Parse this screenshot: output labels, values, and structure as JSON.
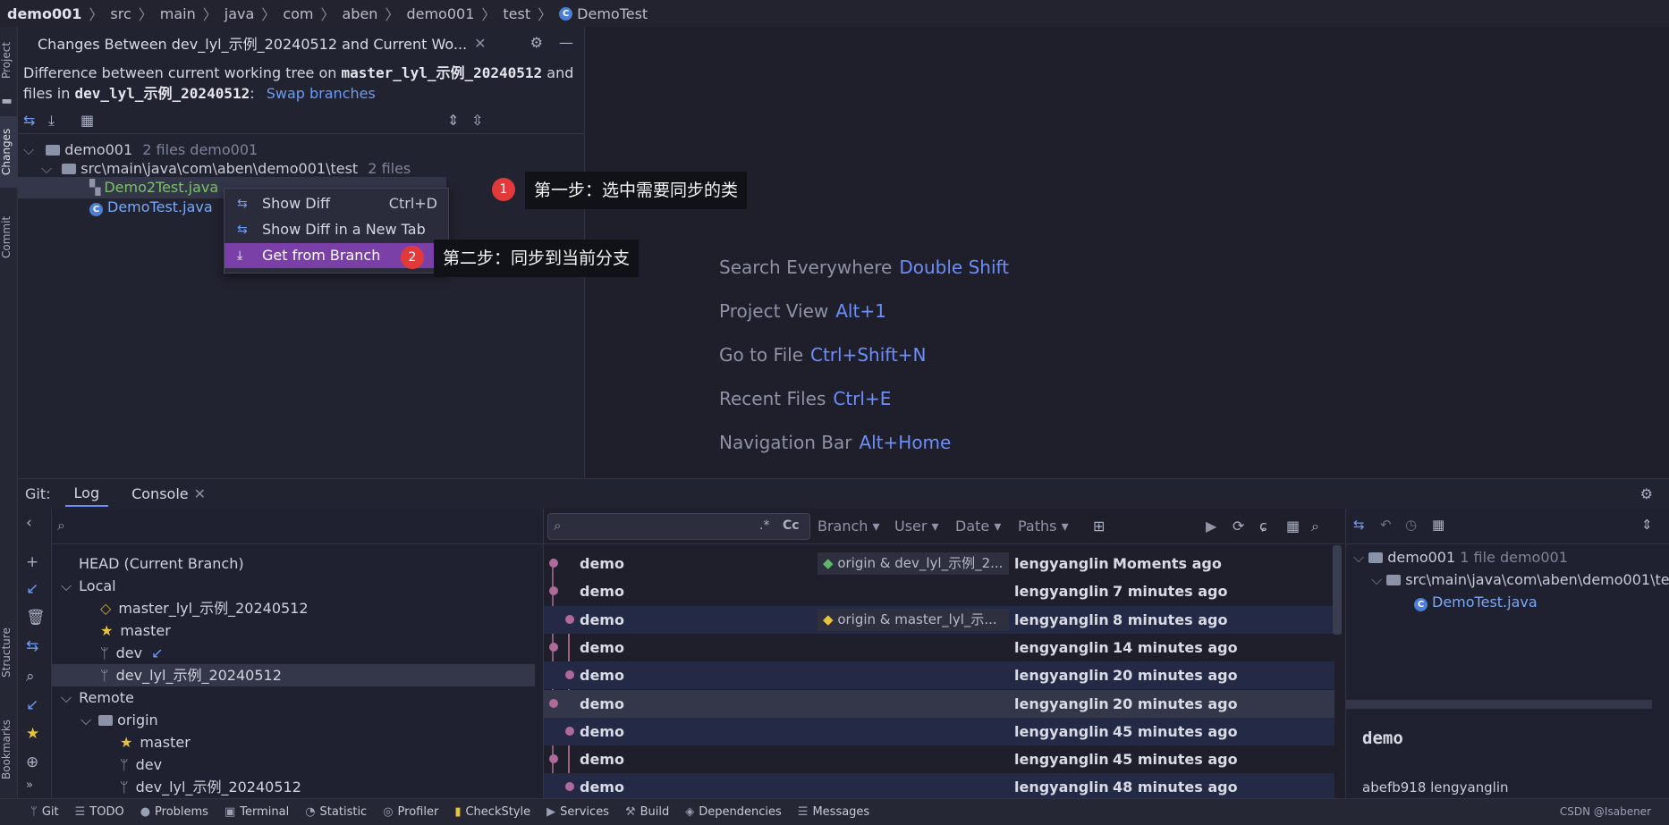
{
  "breadcrumbs": [
    "demo001",
    "src",
    "main",
    "java",
    "com",
    "aben",
    "demo001",
    "test",
    "DemoTest"
  ],
  "side_tabs": {
    "project": "Project",
    "changes": "Changes",
    "commit": "Commit",
    "structure": "Structure",
    "bookmarks": "Bookmarks"
  },
  "changes_panel": {
    "title": "Changes Between dev_lyl_示例_20240512 and Current Wo...",
    "desc_prefix": "Difference between current working tree on",
    "desc_branch1": "master_lyl_示例_20240512",
    "desc_and": "and",
    "desc_files_in": "files in",
    "desc_branch2": "dev_lyl_示例_20240512",
    "desc_colon": ":",
    "swap_link": "Swap branches",
    "tree": {
      "root_name": "demo001",
      "root_info": "2 files  demo001",
      "folder_name": "src\\main\\java\\com\\aben\\demo001\\test",
      "folder_info": "2 files",
      "file1": "Demo2Test.java",
      "file2": "DemoTest.java"
    }
  },
  "context_menu": {
    "item1": "Show Diff",
    "item1_shortcut": "Ctrl+D",
    "item2": "Show Diff in a New Tab",
    "item3": "Get from Branch"
  },
  "annotations": {
    "step1_num": "1",
    "step1_text": "第一步：选中需要同步的类",
    "step2_num": "2",
    "step2_text": "第二步：同步到当前分支"
  },
  "editor_hints": [
    {
      "label": "Search Everywhere",
      "key": "Double Shift"
    },
    {
      "label": "Project View",
      "key": "Alt+1"
    },
    {
      "label": "Go to File",
      "key": "Ctrl+Shift+N"
    },
    {
      "label": "Recent Files",
      "key": "Ctrl+E"
    },
    {
      "label": "Navigation Bar",
      "key": "Alt+Home"
    }
  ],
  "git_toolwindow": {
    "label": "Git:",
    "tab_log": "Log",
    "tab_console": "Console"
  },
  "branches": {
    "head": "HEAD (Current Branch)",
    "local_label": "Local",
    "local": [
      "master_lyl_示例_20240512",
      "master",
      "dev",
      "dev_lyl_示例_20240512"
    ],
    "remote_label": "Remote",
    "origin_label": "origin",
    "remote": [
      "master",
      "dev",
      "dev_lyl_示例_20240512"
    ]
  },
  "log_toolbar": {
    "branch": "Branch",
    "user": "User",
    "date": "Date",
    "paths": "Paths",
    "regex": ".*",
    "case": "Cc"
  },
  "log_rows": [
    {
      "subject": "demo",
      "tag": "origin & dev_lyl_示例_2...",
      "author": "lengyanglin",
      "date": "Moments ago"
    },
    {
      "subject": "demo",
      "tag": "",
      "author": "lengyanglin",
      "date": "7 minutes ago"
    },
    {
      "subject": "demo",
      "tag": "origin & master_lyl_示...",
      "author": "lengyanglin",
      "date": "8 minutes ago"
    },
    {
      "subject": "demo",
      "tag": "",
      "author": "lengyanglin",
      "date": "14 minutes ago"
    },
    {
      "subject": "demo",
      "tag": "",
      "author": "lengyanglin",
      "date": "20 minutes ago"
    },
    {
      "subject": "demo",
      "tag": "",
      "author": "lengyanglin",
      "date": "20 minutes ago"
    },
    {
      "subject": "demo",
      "tag": "",
      "author": "lengyanglin",
      "date": "45 minutes ago"
    },
    {
      "subject": "demo",
      "tag": "",
      "author": "lengyanglin",
      "date": "45 minutes ago"
    },
    {
      "subject": "demo",
      "tag": "",
      "author": "lengyanglin",
      "date": "48 minutes ago"
    }
  ],
  "details": {
    "root_name": "demo001",
    "root_info": "1 file  demo001",
    "folder_name": "src\\main\\java\\com\\aben\\demo001\\te",
    "file": "DemoTest.java",
    "commit_subject": "demo",
    "commit_meta": "abefb918 lengyanglin"
  },
  "statusbar": [
    "Git",
    "TODO",
    "Problems",
    "Terminal",
    "Statistic",
    "Profiler",
    "CheckStyle",
    "Services",
    "Build",
    "Dependencies",
    "Messages"
  ],
  "watermark": "CSDN @Isabener",
  "colors": {
    "accent": "#6d8ef7",
    "selection": "#7b3fa8",
    "badge": "#e23a3a",
    "added_file": "#7cbf6a",
    "modified_file": "#7aa8f5"
  }
}
